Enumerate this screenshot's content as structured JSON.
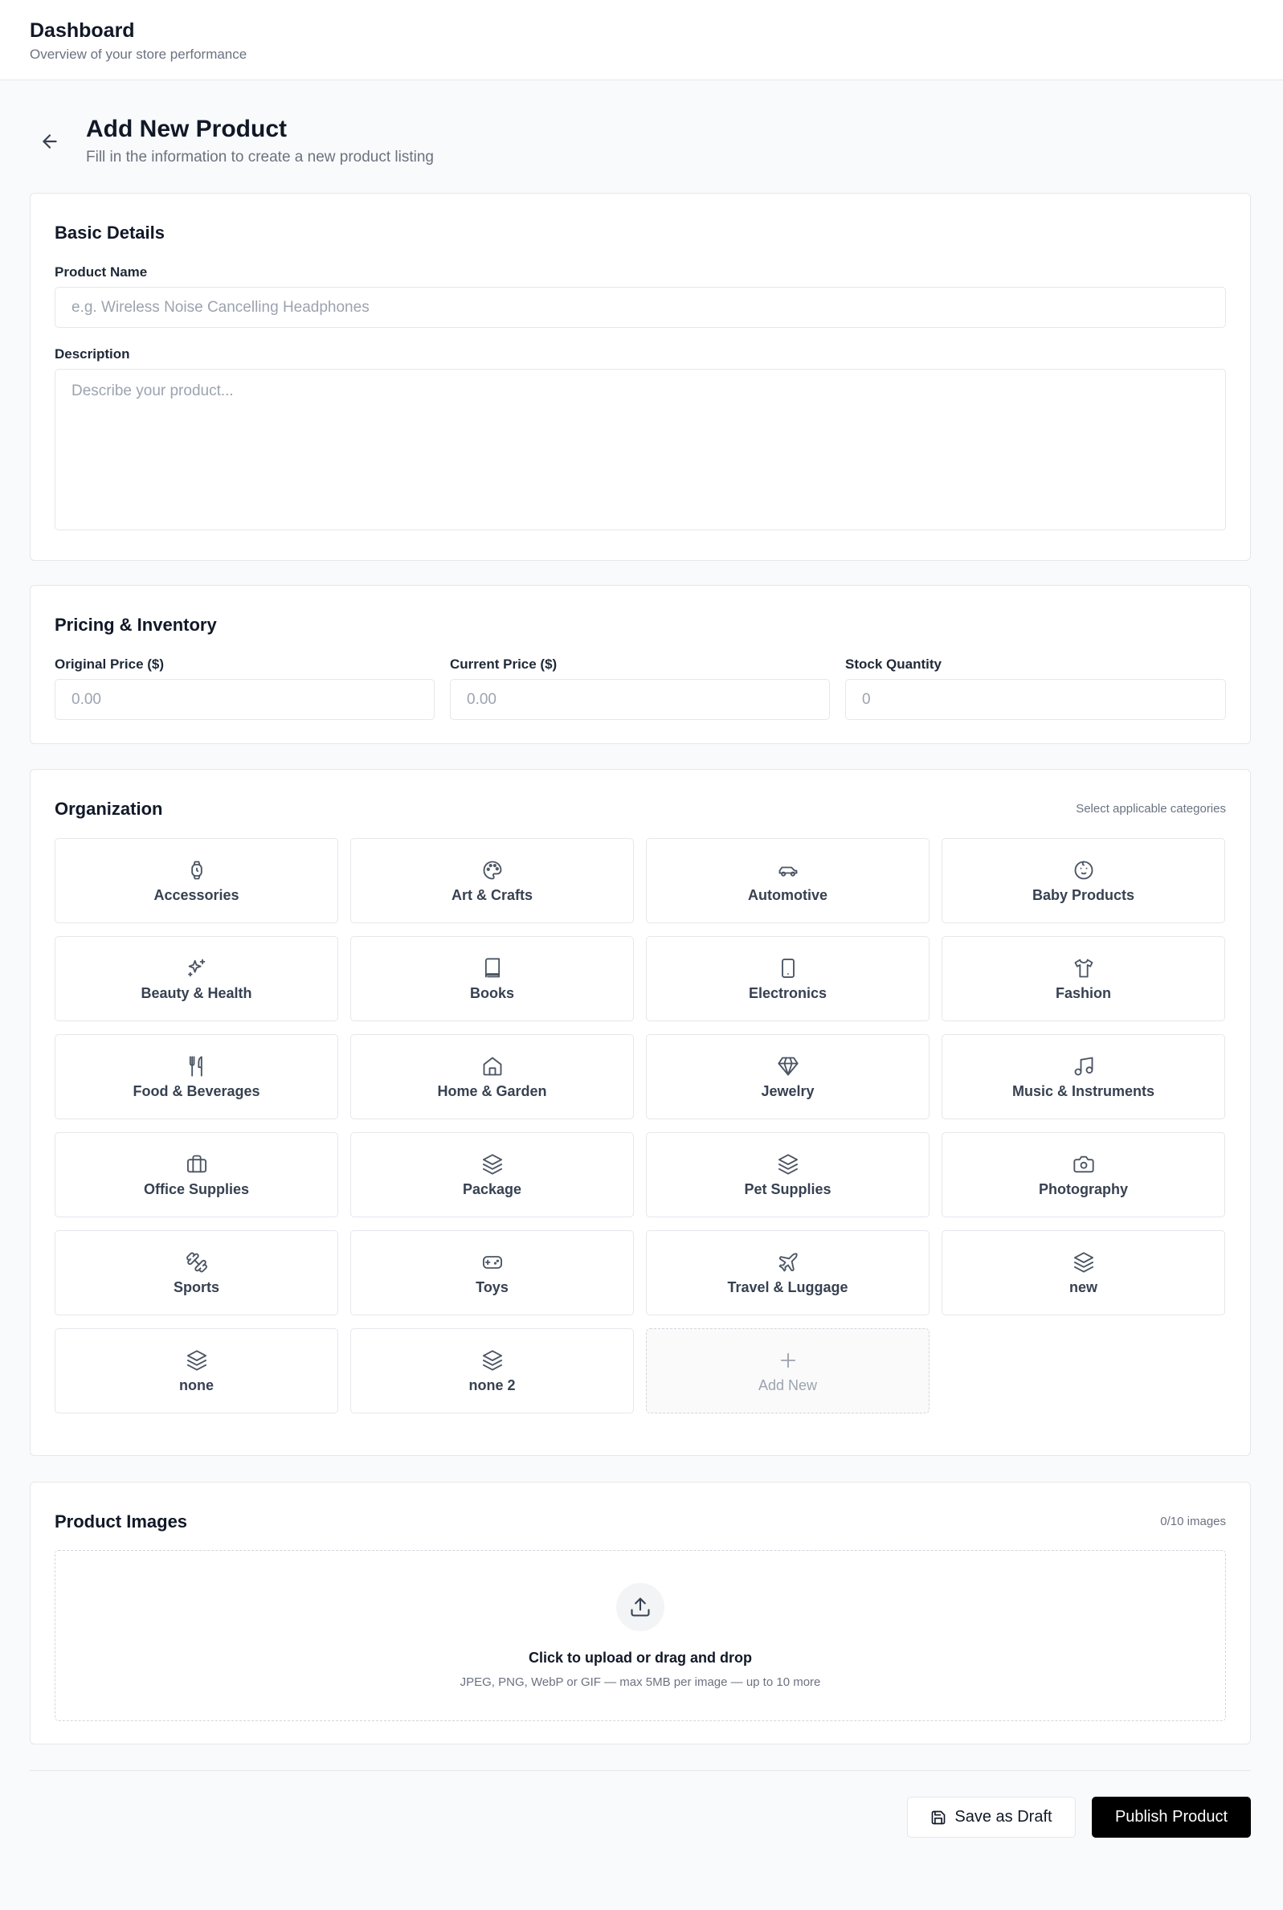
{
  "topbar": {
    "title": "Dashboard",
    "subtitle": "Overview of your store performance"
  },
  "page": {
    "title": "Add New Product",
    "subtitle": "Fill in the information to create a new product listing"
  },
  "basic": {
    "title": "Basic Details",
    "name_label": "Product Name",
    "name_placeholder": "e.g. Wireless Noise Cancelling Headphones",
    "desc_label": "Description",
    "desc_placeholder": "Describe your product..."
  },
  "pricing": {
    "title": "Pricing & Inventory",
    "original_label": "Original Price ($)",
    "original_placeholder": "0.00",
    "current_label": "Current Price ($)",
    "current_placeholder": "0.00",
    "stock_label": "Stock Quantity",
    "stock_placeholder": "0"
  },
  "organization": {
    "title": "Organization",
    "hint": "Select applicable categories",
    "categories": [
      {
        "label": "Accessories",
        "icon": "watch-icon"
      },
      {
        "label": "Art & Crafts",
        "icon": "palette-icon"
      },
      {
        "label": "Automotive",
        "icon": "car-icon"
      },
      {
        "label": "Baby Products",
        "icon": "baby-icon"
      },
      {
        "label": "Beauty & Health",
        "icon": "sparkles-icon"
      },
      {
        "label": "Books",
        "icon": "book-icon"
      },
      {
        "label": "Electronics",
        "icon": "smartphone-icon"
      },
      {
        "label": "Fashion",
        "icon": "shirt-icon"
      },
      {
        "label": "Food & Beverages",
        "icon": "utensils-icon"
      },
      {
        "label": "Home & Garden",
        "icon": "house-icon"
      },
      {
        "label": "Jewelry",
        "icon": "gem-icon"
      },
      {
        "label": "Music & Instruments",
        "icon": "music-icon"
      },
      {
        "label": "Office Supplies",
        "icon": "briefcase-icon"
      },
      {
        "label": "Package",
        "icon": "layers-icon"
      },
      {
        "label": "Pet Supplies",
        "icon": "layers-icon"
      },
      {
        "label": "Photography",
        "icon": "camera-icon"
      },
      {
        "label": "Sports",
        "icon": "dumbbell-icon"
      },
      {
        "label": "Toys",
        "icon": "gamepad-icon"
      },
      {
        "label": "Travel & Luggage",
        "icon": "plane-icon"
      },
      {
        "label": "new",
        "icon": "layers-icon"
      },
      {
        "label": "none",
        "icon": "layers-icon"
      },
      {
        "label": "none 2",
        "icon": "layers-icon"
      }
    ],
    "add_new_label": "Add New"
  },
  "images": {
    "title": "Product Images",
    "count": "0/10 images",
    "upload_main": "Click to upload or drag and drop",
    "upload_sub": "JPEG, PNG, WebP or GIF — max 5MB per image — up to 10 more"
  },
  "actions": {
    "draft_label": "Save as Draft",
    "publish_label": "Publish Product"
  }
}
